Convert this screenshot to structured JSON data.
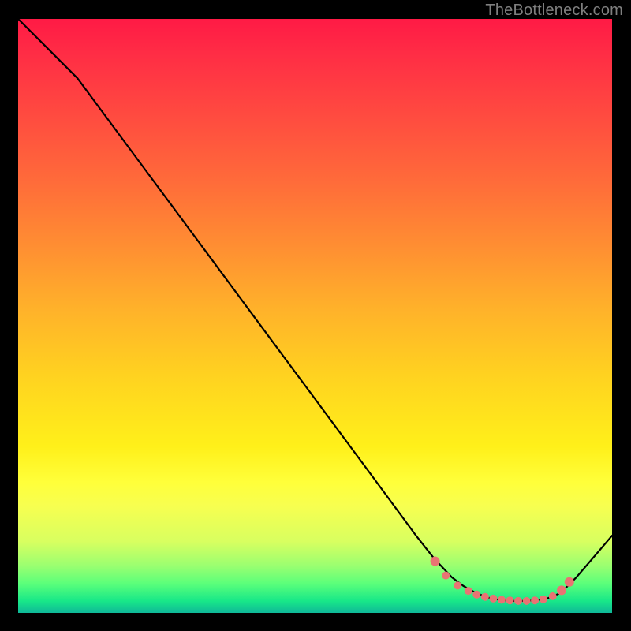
{
  "watermark": "TheBottleneck.com",
  "colors": {
    "dot": "#e97373",
    "line": "#000000"
  },
  "chart_data": {
    "type": "line",
    "title": "",
    "xlabel": "",
    "ylabel": "",
    "xlim": [
      0,
      100
    ],
    "ylim": [
      0,
      100
    ],
    "grid": false,
    "legend": false,
    "series": [
      {
        "name": "bottleneck-curve",
        "x": [
          0,
          6,
          10,
          20,
          30,
          40,
          50,
          60,
          67,
          70,
          73,
          75,
          77,
          79,
          81,
          83,
          85,
          87,
          89,
          91,
          92,
          94,
          100
        ],
        "y": [
          100,
          94,
          90,
          76.5,
          63,
          49.5,
          36,
          22.5,
          13,
          9.2,
          6.0,
          4.5,
          3.4,
          2.6,
          2.2,
          2.0,
          2.0,
          2.1,
          2.4,
          3.2,
          4.0,
          6.0,
          13
        ]
      }
    ],
    "dots": {
      "name": "highlight-dots",
      "x": [
        70.2,
        72.0,
        74.0,
        75.8,
        77.2,
        78.6,
        80.0,
        81.4,
        82.8,
        84.2,
        85.6,
        87.0,
        88.4,
        90.0,
        91.5,
        92.8
      ],
      "y": [
        8.7,
        6.3,
        4.6,
        3.7,
        3.1,
        2.7,
        2.4,
        2.2,
        2.1,
        2.0,
        2.0,
        2.1,
        2.3,
        2.8,
        3.8,
        5.2
      ]
    }
  }
}
